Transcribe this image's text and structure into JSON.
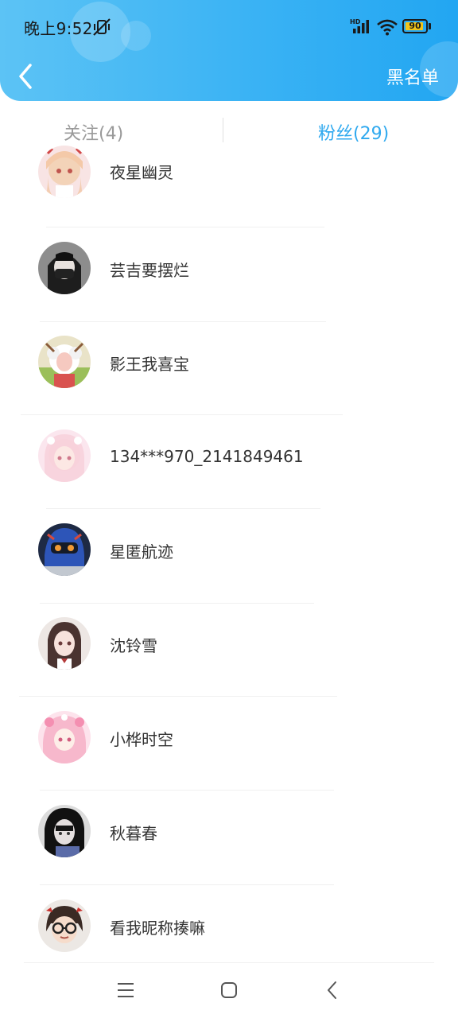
{
  "status_bar": {
    "time": "晚上9:52",
    "network_label": "HD",
    "battery": "90",
    "battery_level": 0.9
  },
  "header": {
    "back_icon": "chevron-left-icon",
    "blacklist_label": "黑名单",
    "colors": {
      "gradient_start": "#5cc3f5",
      "gradient_end": "#22a6f2"
    }
  },
  "tabs": {
    "follow_label": "关注(4)",
    "fans_label": "粉丝(29)",
    "active": "fans",
    "active_color": "#2fa9ef"
  },
  "fans": [
    {
      "name": "夜星幽灵"
    },
    {
      "name": "芸吉要摆烂"
    },
    {
      "name": "影王我喜宝"
    },
    {
      "name": "134***970_2141849461"
    },
    {
      "name": "星匿航迹"
    },
    {
      "name": "沈铃雪"
    },
    {
      "name": "小桦时空"
    },
    {
      "name": "秋暮春"
    },
    {
      "name": "看我昵称揍嘛"
    }
  ],
  "nav_bar": {
    "icons": [
      "menu-icon",
      "home-icon",
      "back-icon"
    ]
  }
}
